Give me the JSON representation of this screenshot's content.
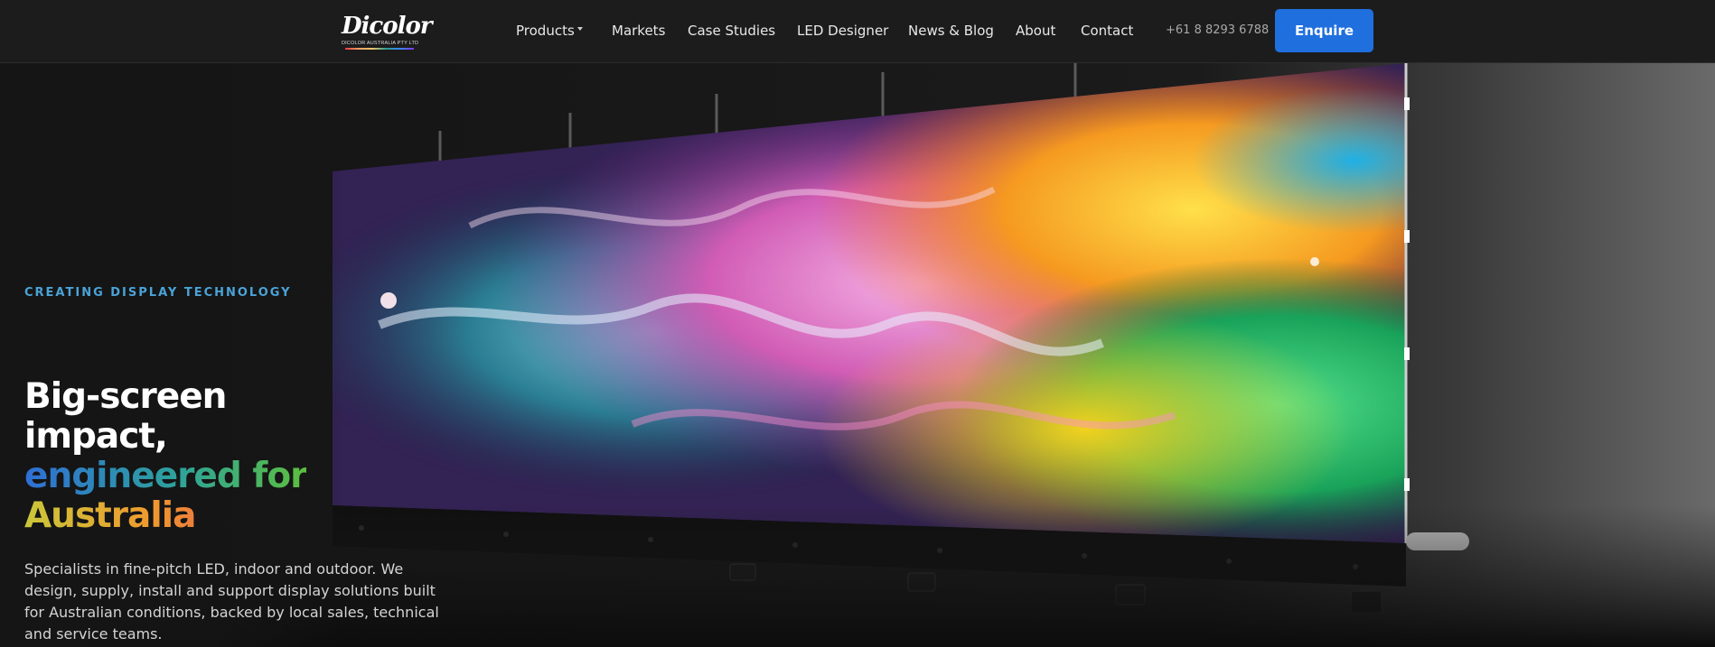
{
  "header": {
    "logo_text": "Dicolor",
    "logo_subtext": "DICOLOR AUSTRALIA PTY LTD",
    "nav": [
      {
        "label": "Products"
      },
      {
        "label": "Markets"
      },
      {
        "label": "Case Studies"
      },
      {
        "label": "LED Designer"
      },
      {
        "label": "News & Blog"
      },
      {
        "label": "About"
      },
      {
        "label": "Contact"
      }
    ],
    "phone": "+61 8 8293 6788",
    "cta_label": "Enquire"
  },
  "hero": {
    "eyebrow": "CREATING DISPLAY TECHNOLOGY",
    "headline_line1": "Big-screen",
    "headline_line2": "impact,",
    "headline_line3": "engineered for",
    "headline_line4": "Australia",
    "description": "Specialists in fine-pitch LED, indoor and outdoor. We design, supply, install and support display solutions built for Australian conditions, backed by local sales, technical and service teams."
  },
  "colors": {
    "accent": "#1f6fde",
    "eyebrow": "#4aa3d8",
    "background": "#161616"
  },
  "icons": {
    "products_dropdown": "chevron-down-icon"
  }
}
